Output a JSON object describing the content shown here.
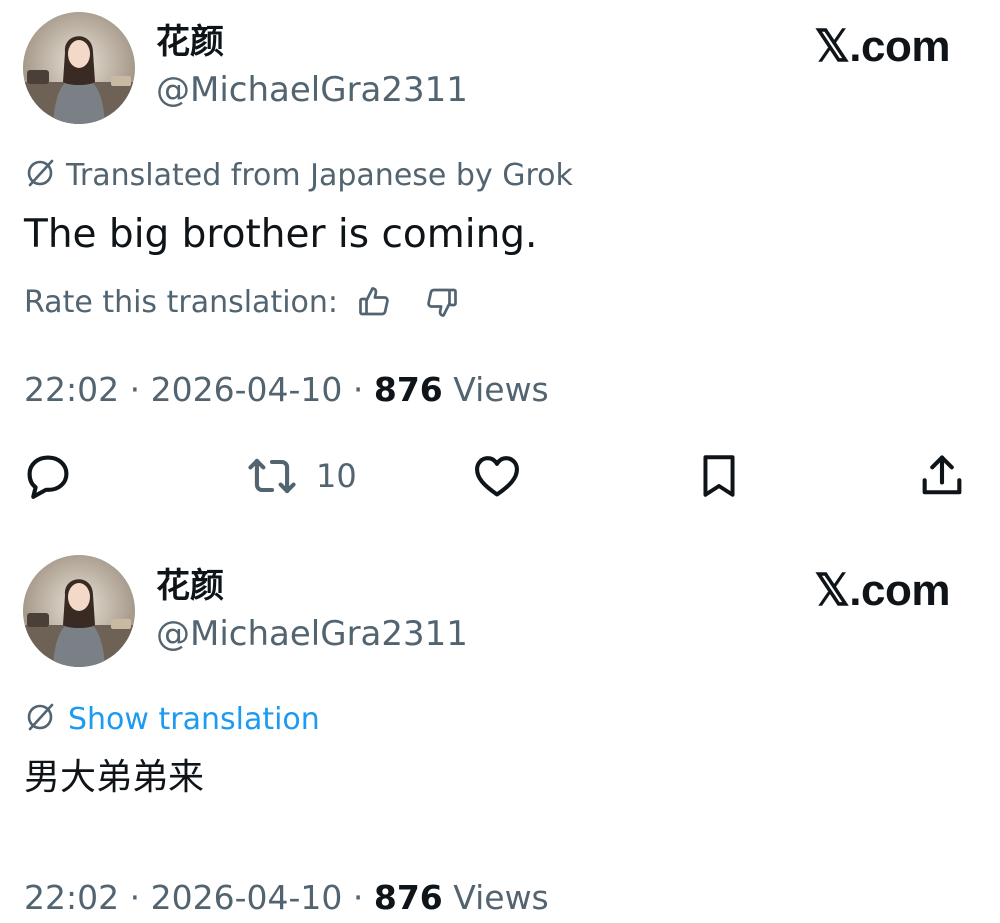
{
  "tweets": [
    {
      "author": {
        "display_name": "花颜",
        "handle": "@MichaelGra2311"
      },
      "brand": "𝕏.com",
      "translation_note": "Translated from Japanese by Grok",
      "text": "The big brother is coming.",
      "rate": {
        "label": "Rate this translation:",
        "thumbs_up_icon": "thumbs-up-icon",
        "thumbs_down_icon": "thumbs-down-icon"
      },
      "meta": {
        "time": "22:02",
        "separator": " · ",
        "date": "2026-04-10",
        "views_count": "876",
        "views_label": "Views"
      },
      "actions": {
        "reply_icon": "reply-icon",
        "repost_icon": "repost-icon",
        "repost_count": "10",
        "like_icon": "heart-icon",
        "bookmark_icon": "bookmark-icon",
        "share_icon": "share-icon"
      }
    },
    {
      "author": {
        "display_name": "花颜",
        "handle": "@MichaelGra2311"
      },
      "brand": "𝕏.com",
      "show_translation": "Show translation",
      "text": "男大弟弟来",
      "meta": {
        "time": "22:02",
        "separator": " · ",
        "date": "2026-04-10",
        "views_count": "876",
        "views_label": "Views"
      }
    }
  ],
  "colors": {
    "text_primary": "#0f1419",
    "text_secondary": "#536471",
    "link": "#1d9bf0",
    "background": "#ffffff"
  }
}
